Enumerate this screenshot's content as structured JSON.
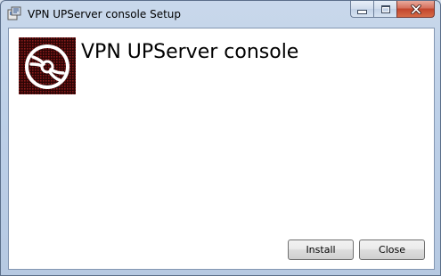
{
  "window": {
    "title": "VPN UPServer console Setup",
    "icon": "installer-icon"
  },
  "caption_buttons": {
    "minimize_icon": "minimize-icon",
    "maximize_icon": "maximize-icon",
    "close_icon": "close-icon"
  },
  "header": {
    "product_icon": "disc-icon",
    "product_title": "VPN UPServer console"
  },
  "buttons": {
    "install_label": "Install",
    "close_label": "Close"
  },
  "colors": {
    "close_button": "#c2452d",
    "icon_background": "#5a1010"
  }
}
